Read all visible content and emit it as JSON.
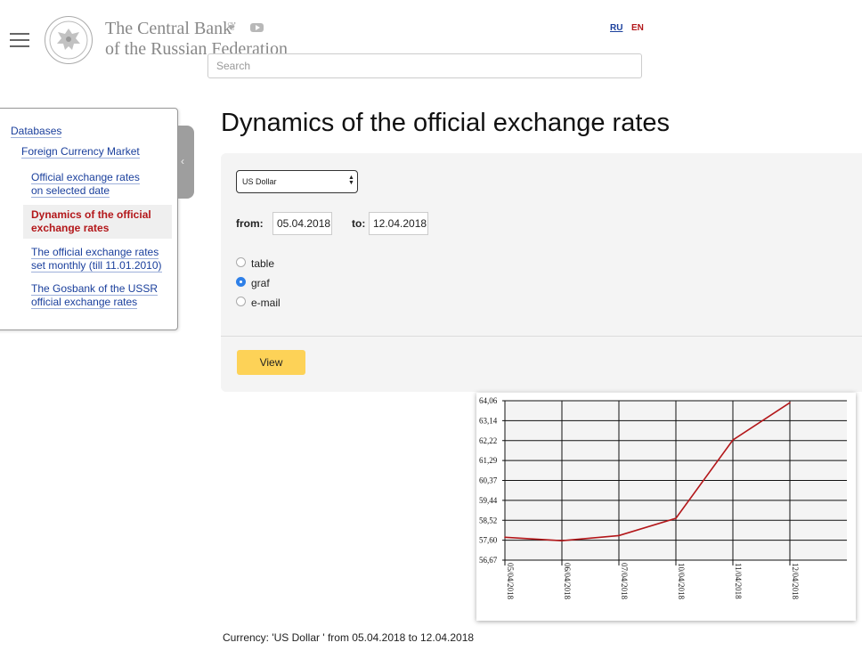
{
  "header": {
    "logo_line1": "The Central Bank",
    "logo_line2": "of the Russian Federation",
    "lang_ru": "RU",
    "lang_en": "EN",
    "search_placeholder": "Search"
  },
  "sidebar": {
    "root": "Databases",
    "section": "Foreign Currency Market",
    "items": [
      {
        "line1": "Official exchange rates",
        "line2": "on selected date"
      },
      {
        "line1": "Dynamics of the official",
        "line2": "exchange rates",
        "active": true
      },
      {
        "line1": "The official exchange rates",
        "line2": "set monthly (till 11.01.2010)"
      },
      {
        "line1": "The Gosbank of the USSR",
        "line2": "official exchange rates"
      }
    ]
  },
  "main": {
    "title": "Dynamics of the official exchange rates",
    "currency_selected": "US Dollar",
    "from_label": "from:",
    "from_value": "05.04.2018",
    "to_label": "to:",
    "to_value": "12.04.2018",
    "options": [
      "table",
      "graf",
      "e-mail"
    ],
    "selected_option": "graf",
    "view_button": "View",
    "caption": "Currency: 'US Dollar ' from 05.04.2018 to 12.04.2018"
  },
  "colors": {
    "accent_red": "#b3171a",
    "link_blue": "#1a3f9c",
    "button_yellow": "#fdd257",
    "radio_blue": "#2f80e8",
    "line_color": "#b3171a"
  },
  "chart_data": {
    "type": "line",
    "x": [
      "05/04/2018",
      "06/04/2018",
      "07/04/2018",
      "10/04/2018",
      "11/04/2018",
      "12/04/2018"
    ],
    "series": [
      {
        "values": [
          57.73,
          57.57,
          57.81,
          58.61,
          62.24,
          63.97
        ]
      }
    ],
    "yticks": [
      "64,06",
      "63,14",
      "62,22",
      "61,29",
      "60,37",
      "59,44",
      "58,52",
      "57,60",
      "56,67"
    ],
    "ylim": [
      56.67,
      64.06
    ],
    "grid": true
  }
}
